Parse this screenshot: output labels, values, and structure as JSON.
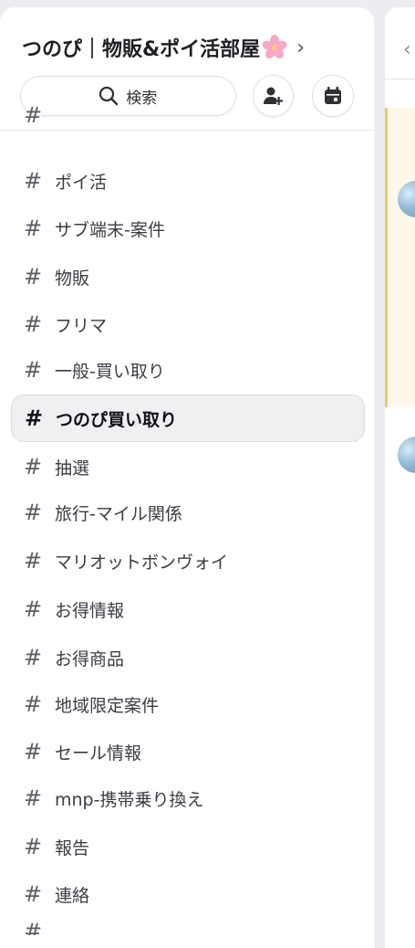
{
  "server": {
    "name": "つのぴ｜物販&ポイ活部屋",
    "emoji": "cherry-blossom-icon",
    "chevron": "›"
  },
  "actions": {
    "search_label": "検索",
    "invite_icon": "add-user-icon",
    "events_icon": "calendar-icon"
  },
  "channels": [
    {
      "name": "ポイ活"
    },
    {
      "name": "サブ端末-案件"
    },
    {
      "name": "物販"
    },
    {
      "name": "フリマ"
    },
    {
      "name": "一般-買い取り"
    },
    {
      "name": "つのぴ買い取り",
      "active": true
    },
    {
      "name": "抽選"
    },
    {
      "name": "旅行-マイル関係"
    },
    {
      "name": "マリオットボンヴォイ"
    },
    {
      "name": "お得情報"
    },
    {
      "name": "お得商品"
    },
    {
      "name": "地域限定案件"
    },
    {
      "name": "セール情報"
    },
    {
      "name": "mnp-携帯乗り換え"
    },
    {
      "name": "報告"
    },
    {
      "name": "連絡"
    }
  ],
  "hash_symbol": "#",
  "colors": {
    "accent_highlight": "#f0c766",
    "active_channel_bg": "#eff0f2",
    "panel_bg": "#ffffff",
    "backdrop": "#ebedf1"
  }
}
